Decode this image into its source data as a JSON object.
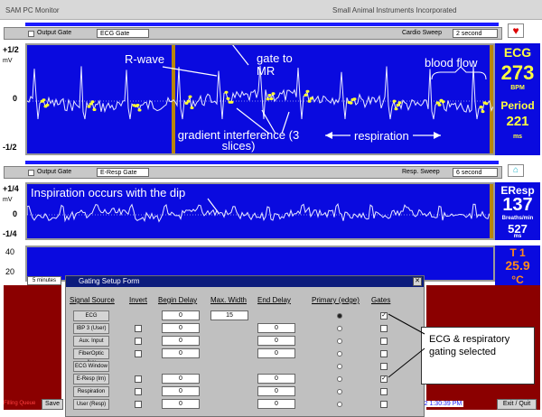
{
  "window": {
    "title": "SAM PC Monitor",
    "subtitle": "Small Animal Instruments Incorporated"
  },
  "ecg": {
    "output_gate_label": "Output Gate",
    "gate_name": "ECG Gate",
    "sweep_label": "Cardio Sweep",
    "sweep_value": "2 second",
    "axis_top": "+1/2",
    "axis_unit": "mV",
    "axis_mid": "0",
    "axis_bottom": "-1/2",
    "title": "ECG",
    "rate": "273",
    "rate_unit": "BPM",
    "period_label": "Period",
    "period_value": "221",
    "period_unit": "ms"
  },
  "eresp": {
    "output_gate_label": "Output Gate",
    "gate_name": "E-Resp Gate",
    "sweep_label": "Resp. Sweep",
    "sweep_value": "6 second",
    "axis_top": "+1/4",
    "axis_unit": "mV",
    "axis_mid": "0",
    "axis_bottom": "-1/4",
    "title": "EResp",
    "rate": "137",
    "rate_unit": "Breaths/min",
    "period_value": "527",
    "period_unit": "ms"
  },
  "temp": {
    "axis_top": "40",
    "axis_bottom": "20",
    "minutes_label": "5 minutes",
    "title": "T 1",
    "value": "25.9",
    "unit": "°C"
  },
  "annotations": {
    "r_wave": "R-wave",
    "gate_to_mr": "gate to MR",
    "blood_flow": "blood flow",
    "gradient_interference": "gradient interference (3 slices)",
    "respiration": "respiration",
    "inspiration": "Inspiration occurs with the dip"
  },
  "dialog": {
    "title": "Gating Setup Form",
    "columns": [
      "Signal Source",
      "Invert",
      "Begin Delay",
      "Max. Width",
      "End Delay",
      "Primary (edge)",
      "Gates"
    ],
    "rows": [
      {
        "source": "ECG",
        "begin": "0",
        "width": "15",
        "end": "",
        "gate": "✓"
      },
      {
        "source": "IBP 3 (User)",
        "begin": "0",
        "width": "",
        "end": "0",
        "gate": ""
      },
      {
        "source": "Aux. Input",
        "begin": "0",
        "width": "",
        "end": "0",
        "gate": ""
      },
      {
        "source": "FiberOptic Aux",
        "begin": "0",
        "width": "",
        "end": "0",
        "gate": ""
      },
      {
        "source": "ECG Window",
        "begin": "",
        "width": "",
        "end": "",
        "gate": ""
      },
      {
        "source": "E-Resp (Im)",
        "begin": "0",
        "width": "",
        "end": "0",
        "gate": "✓"
      },
      {
        "source": "Respiration",
        "begin": "0",
        "width": "",
        "end": "0",
        "gate": ""
      },
      {
        "source": "User (Resp)",
        "begin": "0",
        "width": "",
        "end": "0",
        "gate": ""
      }
    ]
  },
  "bottom": {
    "filling_queue": "Filling Queue",
    "save": "Save",
    "timestamp": "25/02 1:30:39 PM",
    "exit": "Exit / Quit"
  },
  "callout": "ECG & respiratory gating selected",
  "colors": {
    "plot_bg": "#0a0adf",
    "readout": "#ffff40",
    "temp_readout": "#ff8c1a",
    "dark_red": "#8b0000",
    "trace": "#e8e8ff",
    "highlight": "#ffff30"
  }
}
